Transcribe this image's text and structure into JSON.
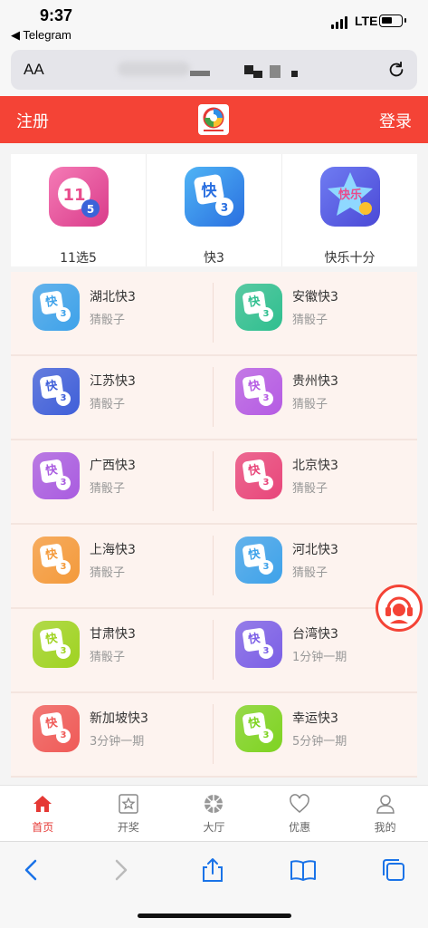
{
  "status_bar": {
    "time": "9:37",
    "back_app": "◀ Telegram",
    "network": "LTE"
  },
  "address_bar": {
    "aa_label": "AA"
  },
  "header": {
    "register": "注册",
    "login": "登录"
  },
  "top_categories": [
    {
      "label": "11选5",
      "icon": "lottery-11x5-icon",
      "color": "#e94b8c"
    },
    {
      "label": "快3",
      "icon": "kuai3-icon",
      "color": "#2f8fe6"
    },
    {
      "label": "快乐十分",
      "icon": "happy-ten-icon",
      "color": "#5b5de6"
    }
  ],
  "games": [
    {
      "name": "湖北快3",
      "desc": "猜骰子",
      "color": "#3ea2ea"
    },
    {
      "name": "安徽快3",
      "desc": "猜骰子",
      "color": "#2fbf8f"
    },
    {
      "name": "江苏快3",
      "desc": "猜骰子",
      "color": "#3f5fd9"
    },
    {
      "name": "贵州快3",
      "desc": "猜骰子",
      "color": "#b55be3"
    },
    {
      "name": "广西快3",
      "desc": "猜骰子",
      "color": "#a95ce0"
    },
    {
      "name": "北京快3",
      "desc": "猜骰子",
      "color": "#e8467a"
    },
    {
      "name": "上海快3",
      "desc": "猜骰子",
      "color": "#f49a3b"
    },
    {
      "name": "河北快3",
      "desc": "猜骰子",
      "color": "#3ea2ea"
    },
    {
      "name": "甘肃快3",
      "desc": "猜骰子",
      "color": "#9fd321"
    },
    {
      "name": "台湾快3",
      "desc": "1分钟一期",
      "color": "#7b5fe6"
    },
    {
      "name": "新加坡快3",
      "desc": "3分钟一期",
      "color": "#ef5a57"
    },
    {
      "name": "幸运快3",
      "desc": "5分钟一期",
      "color": "#7ed321"
    }
  ],
  "icon_glyph": "快",
  "icon_dice": "3",
  "tabbar": [
    {
      "label": "首页",
      "icon": "home-icon",
      "active": true
    },
    {
      "label": "开奖",
      "icon": "draw-results-icon",
      "active": false
    },
    {
      "label": "大厅",
      "icon": "lobby-icon",
      "active": false
    },
    {
      "label": "优惠",
      "icon": "heart-icon",
      "active": false
    },
    {
      "label": "我的",
      "icon": "user-icon",
      "active": false
    }
  ],
  "colors": {
    "brand_red": "#f44336",
    "active_tab": "#e53935"
  }
}
